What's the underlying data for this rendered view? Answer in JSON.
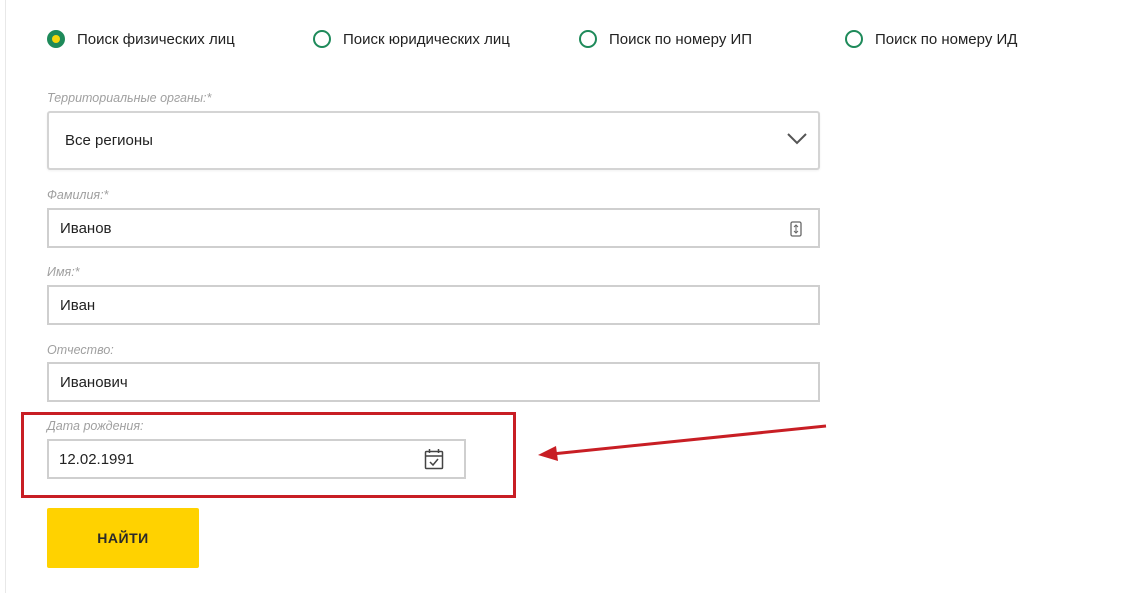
{
  "search_type": {
    "options": [
      {
        "label": "Поиск физических лиц",
        "checked": true
      },
      {
        "label": "Поиск юридических лиц",
        "checked": false
      },
      {
        "label": "Поиск по номеру ИП",
        "checked": false
      },
      {
        "label": "Поиск по номеру ИД",
        "checked": false
      }
    ]
  },
  "form": {
    "region": {
      "label": "Территориальные органы:*",
      "value": "Все регионы"
    },
    "last_name": {
      "label": "Фамилия:*",
      "value": "Иванов"
    },
    "first_name": {
      "label": "Имя:*",
      "value": "Иван"
    },
    "patronymic": {
      "label": "Отчество:",
      "value": "Иванович"
    },
    "birth_date": {
      "label": "Дата рождения:",
      "value": "12.02.1991"
    }
  },
  "search_button": {
    "label": "НАЙТИ"
  },
  "colors": {
    "radio_accent": "#1e8a5a",
    "radio_dot": "#f4d60b",
    "button_bg": "#ffd200",
    "highlight": "#c81e24"
  },
  "icons": {
    "dropdown": "chevron-down-icon",
    "last_name_field": "keyboard-icon",
    "birth_date_field": "calendar-icon"
  }
}
